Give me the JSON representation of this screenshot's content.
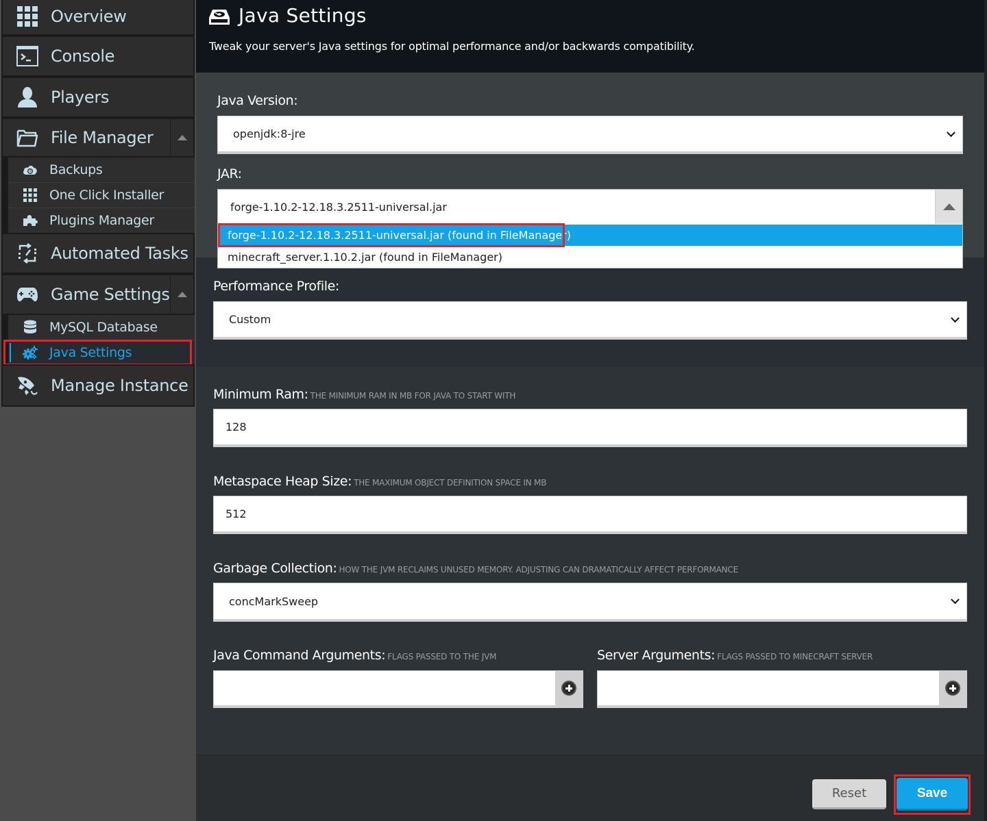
{
  "sidebar": {
    "items": [
      {
        "label": "Overview",
        "icon": "grid-icon"
      },
      {
        "label": "Console",
        "icon": "terminal-icon"
      },
      {
        "label": "Players",
        "icon": "user-icon"
      },
      {
        "label": "File Manager",
        "icon": "folder-icon",
        "expanded": true
      },
      {
        "label": "Automated Tasks",
        "icon": "tasks-icon"
      },
      {
        "label": "Game Settings",
        "icon": "gamepad-icon",
        "expanded": true
      },
      {
        "label": "Manage Instance",
        "icon": "rocket-icon"
      }
    ],
    "file_manager_sub": [
      {
        "label": "Backups",
        "icon": "cloud-backup-icon"
      },
      {
        "label": "One Click Installer",
        "icon": "grid-icon"
      },
      {
        "label": "Plugins Manager",
        "icon": "puzzle-icon"
      }
    ],
    "game_settings_sub": [
      {
        "label": "MySQL Database",
        "icon": "database-icon"
      },
      {
        "label": "Java Settings",
        "icon": "gears-icon",
        "active": true
      }
    ]
  },
  "header": {
    "title": "Java Settings",
    "icon": "hard-drive-icon",
    "description": "Tweak your server's Java settings for optimal performance and/or backwards compatibility."
  },
  "form": {
    "java_version": {
      "label": "Java Version:",
      "value": "openjdk:8-jre"
    },
    "jar": {
      "label": "JAR:",
      "value": "forge-1.10.2-12.18.3.2511-universal.jar",
      "options": [
        {
          "label": "forge-1.10.2-12.18.3.2511-universal.jar (found in FileManager)",
          "highlighted": true
        },
        {
          "label": "minecraft_server.1.10.2.jar (found in FileManager)",
          "highlighted": false
        }
      ]
    },
    "performance_profile": {
      "label": "Performance Profile:",
      "value": "Custom"
    },
    "minimum_ram": {
      "label": "Minimum Ram:",
      "hint": "The minimum RAM in MB for Java to start with",
      "value": "128"
    },
    "metaspace": {
      "label": "Metaspace Heap Size:",
      "hint": "The maximum object definition space in MB",
      "value": "512"
    },
    "garbage_collection": {
      "label": "Garbage Collection:",
      "hint": "How the JVM reclaims unused memory. Adjusting can dramatically affect performance",
      "value": "concMarkSweep"
    },
    "java_args": {
      "label": "Java Command Arguments:",
      "hint": "Flags passed to the JVM",
      "value": ""
    },
    "server_args": {
      "label": "Server Arguments:",
      "hint": "Flags passed to Minecraft server",
      "value": ""
    }
  },
  "buttons": {
    "reset": "Reset",
    "save": "Save"
  },
  "colors": {
    "accent": "#12a4e6",
    "highlight_box": "#e2252b",
    "header_bg": "#0f151b"
  }
}
